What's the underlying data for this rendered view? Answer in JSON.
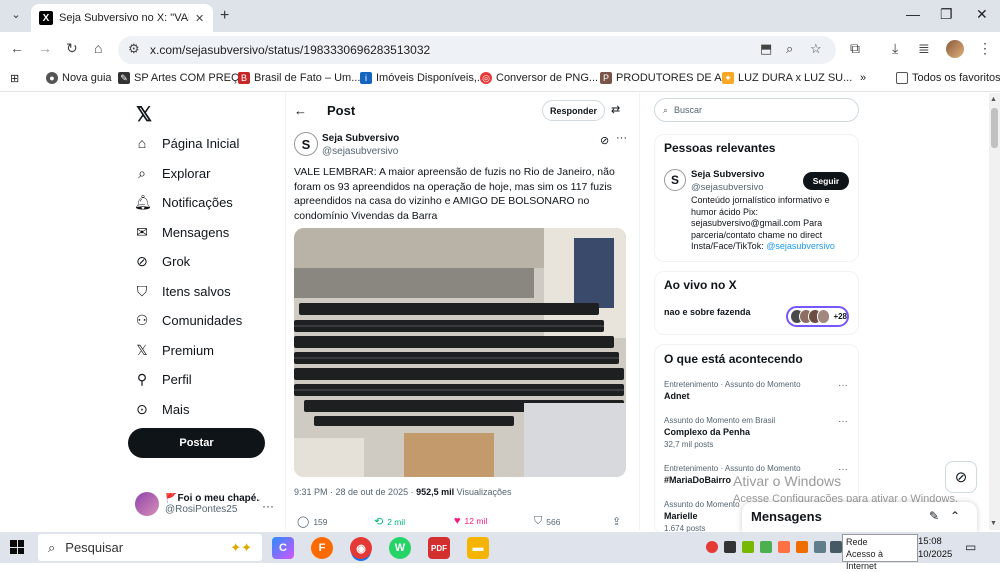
{
  "browser": {
    "tab_title": "Seja Subversivo no X: \"VALE LEMBRAR",
    "url": "x.com/sejasubversivo/status/1983330696283513032",
    "bookmarks": [
      "Nova guia",
      "SP Artes COM PREÇ...",
      "Brasil de Fato – Um...",
      "Imóveis Disponíveis,...",
      "Conversor de PNG...",
      "PRODUTORES DE A...",
      "LUZ DURA x LUZ SU..."
    ],
    "all_bookmarks": "Todos os favoritos"
  },
  "sidebar": {
    "items": [
      "Página Inicial",
      "Explorar",
      "Notificações",
      "Mensagens",
      "Grok",
      "Itens salvos",
      "Comunidades",
      "Premium",
      "Perfil",
      "Mais"
    ],
    "post_button": "Postar",
    "account_name": "🚩Foi o meu chapé...",
    "account_handle": "@RosiPontes25"
  },
  "post": {
    "header": "Post",
    "reply_button": "Responder",
    "author_name": "Seja Subversivo",
    "author_handle": "@sejasubversivo",
    "avatar_letter": "S",
    "text": "VALE LEMBRAR: A maior apreensão de fuzis no Rio de Janeiro, não foram os 93 apreendidos na operação de hoje, mas sim os 117 fuzis apreendidos na casa do vizinho e AMIGO DE BOLSONARO no condomínio Vivendas da Barra",
    "timestamp": "9:31 PM · 28 de out de 2025 · ",
    "views_count": "952,5 mil",
    "views_label": " Visualizações",
    "replies": "159",
    "reposts": "2 mil",
    "likes": "12 mil",
    "bookmarks": "566"
  },
  "right": {
    "search_placeholder": "Buscar",
    "relevant_title": "Pessoas relevantes",
    "rel_name": "Seja Subversivo",
    "rel_handle": "@sejasubversivo",
    "follow_button": "Seguir",
    "rel_bio": "Conteúdo jornalístico informativo e humor ácido Pix: sejasubversivo@gmail.com Para parceria/contato chame no direct Insta/Face/TikTok: ",
    "rel_bio_link": "@sejasubversivo",
    "live_title": "Ao vivo no X",
    "live_text": "nao e sobre fazenda",
    "live_count": "+28",
    "trending_title": "O que está acontecendo",
    "trends": [
      {
        "context": "Entretenimento · Assunto do Momento",
        "name": "Adnet",
        "posts": ""
      },
      {
        "context": "Assunto do Momento em Brasil",
        "name": "Complexo da Penha",
        "posts": "32,7 mil posts"
      },
      {
        "context": "Entretenimento · Assunto do Momento",
        "name": "#MariaDoBairro",
        "posts": ""
      },
      {
        "context": "Assunto do Momento",
        "name": "Marielle",
        "posts": "1.674 posts"
      }
    ]
  },
  "overlay": {
    "activate_title": "Ativar o Windows",
    "activate_sub": "Acesse Configurações para ativar o Windows.",
    "messages_title": "Mensagens"
  },
  "taskbar": {
    "search": "Pesquisar",
    "net_line1": "Rede",
    "net_line2": "Acesso à Internet",
    "time": "15:08",
    "date": "10/2025"
  }
}
